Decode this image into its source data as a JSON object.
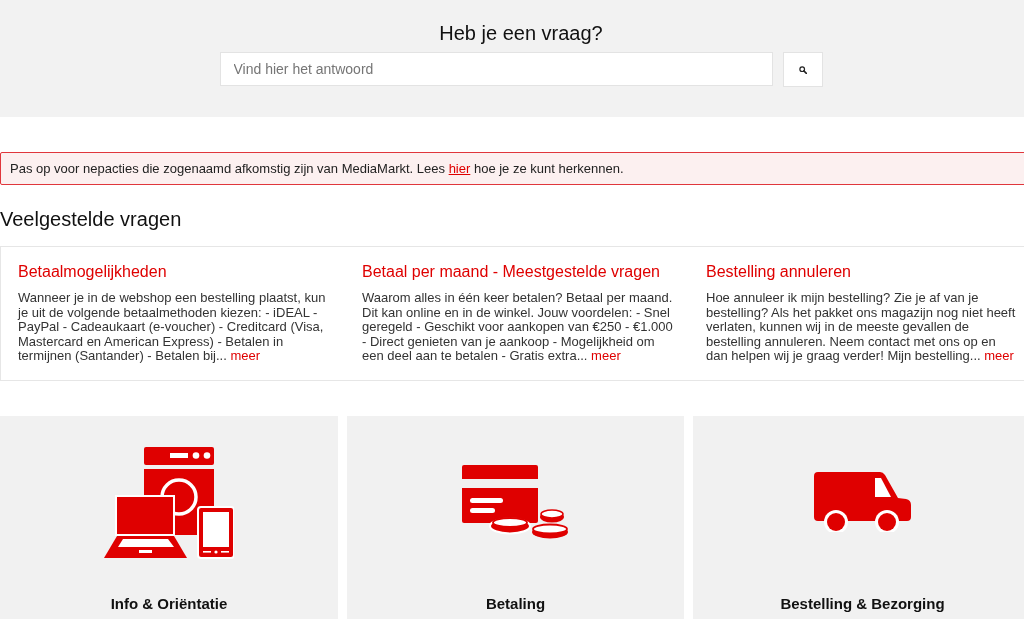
{
  "header": {
    "title": "Heb je een vraag?",
    "search": {
      "placeholder": "Vind hier het antwoord"
    }
  },
  "alert": {
    "text_before": "Pas op voor nepacties die zogenaamd afkomstig zijn van MediaMarkt. Lees ",
    "link": "hier",
    "text_after": " hoe je ze kunt herkennen."
  },
  "faq": {
    "title": "Veelgestelde vragen",
    "items": [
      {
        "title": "Betaalmogelijkheden",
        "summary": "Wanneer je in de webshop een bestelling plaatst, kun je uit de volgende betaalmethoden kiezen: - iDEAL - PayPal - Cadeaukaart (e-voucher) - Creditcard (Visa, Mastercard en American Express) - Betalen in termijnen (Santander) - Betalen bij...",
        "more": "meer"
      },
      {
        "title": "Betaal per maand - Meestgestelde vragen",
        "summary": "Waarom alles in één keer betalen? Betaal per maand. Dit kan online en in de winkel. Jouw voordelen: - Snel geregeld - Geschikt voor aankopen van €250 - €1.000 - Direct genieten van je aankoop - Mogelijkheid om een deel aan te betalen - Gratis extra...",
        "more": "meer"
      },
      {
        "title": "Bestelling annuleren",
        "summary": "Hoe annuleer ik mijn bestelling? Zie je af van je bestelling? Als het pakket ons magazijn nog niet heeft verlaten, kunnen wij in de meeste gevallen de bestelling annuleren. Neem contact met ons op en dan helpen wij je graag verder! Mijn bestelling...",
        "more": "meer"
      }
    ]
  },
  "categories": [
    {
      "kind": "devices",
      "label": "Info & Oriëntatie"
    },
    {
      "kind": "payment",
      "label": "Betaling"
    },
    {
      "kind": "delivery",
      "label": "Bestelling & Bezorging"
    }
  ]
}
